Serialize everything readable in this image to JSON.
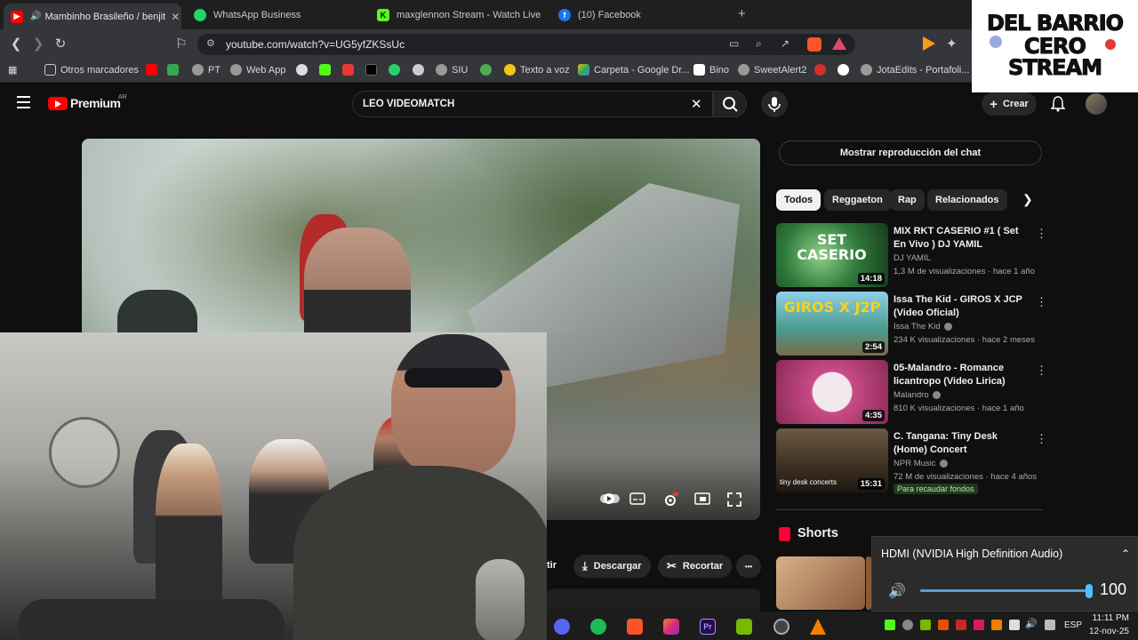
{
  "tabs": [
    {
      "label": "Mambinho Brasileño / benjit",
      "color": "#ff0000",
      "active": true
    },
    {
      "label": "WhatsApp Business",
      "color": "#25d366"
    },
    {
      "label": "maxglennon Stream - Watch Live on",
      "color": "#53fc18"
    },
    {
      "label": "(10) Facebook",
      "color": "#1877f2"
    }
  ],
  "url": "youtube.com/watch?v=UG5yfZKSsUc",
  "bookmarks": [
    {
      "label": "Otros marcadores"
    },
    {
      "label": "PT"
    },
    {
      "label": "Web App"
    },
    {
      "label": "SIU"
    },
    {
      "label": "Texto a voz"
    },
    {
      "label": "Carpeta - Google Dr..."
    },
    {
      "label": "Bino"
    },
    {
      "label": "SweetAlert2"
    },
    {
      "label": "JotaEdits - Portafoli..."
    }
  ],
  "youtube": {
    "brand": "Premium",
    "region": "AR",
    "search_value": "LEO VIDEOMATCH",
    "create_label": "Crear"
  },
  "actions": {
    "partial": "tir",
    "download": "Descargar",
    "clip": "Recortar",
    "more": "•••"
  },
  "sidebar": {
    "chat_button": "Mostrar reproducción del chat",
    "chips": [
      "Todos",
      "Reggaeton",
      "Rap",
      "Relacionados"
    ],
    "videos": [
      {
        "title": "MIX RKT CASERIO #1 ( Set En Vivo ) DJ YAMIL",
        "channel": "DJ YAMIL",
        "meta": "1,3 M de visualizaciones · hace 1 año",
        "duration": "14:18",
        "thumb_text": "SET CASERIO",
        "color": "#2f7a3a"
      },
      {
        "title": "Issa The Kid - GIROS X JCP (Video Oficial)",
        "channel": "Issa The Kid",
        "meta": "234 K visualizaciones · hace 2 meses",
        "duration": "2:54",
        "thumb_text": "GIROS X J2P",
        "color": "#4b9a8c"
      },
      {
        "title": "05-Malandro - Romance licantropo (Video Lirica)",
        "channel": "Malandro",
        "meta": "810 K visualizaciones · hace 1 año",
        "duration": "4:35",
        "thumb_text": "",
        "color": "#c94b86"
      },
      {
        "title": "C. Tangana: Tiny Desk (Home) Concert",
        "channel": "NPR Music",
        "meta": "72 M de visualizaciones · hace 4 años",
        "duration": "15:31",
        "thumb_text": "tiny desk concerts",
        "color": "#5a4634",
        "badge": "Para recaudar fondos"
      }
    ],
    "shorts_label": "Shorts"
  },
  "volume": {
    "device": "HDMI (NVIDIA High Definition Audio)",
    "level": 100
  },
  "taskbar": {
    "lang": "ESP",
    "time": "11:11 PM",
    "date": "12-nov-25"
  },
  "logo": {
    "line1": "DEL BARRIO",
    "line2": "CERO",
    "line3": "STREAM"
  }
}
